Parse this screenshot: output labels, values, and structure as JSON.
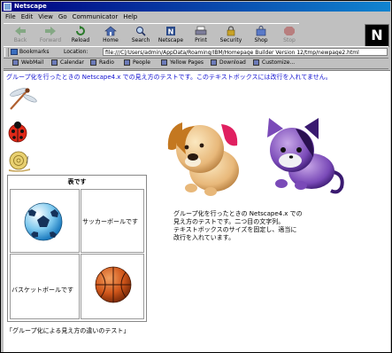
{
  "window": {
    "title": "Netscape"
  },
  "menu": [
    "File",
    "Edit",
    "View",
    "Go",
    "Communicator",
    "Help"
  ],
  "toolbar": {
    "buttons": [
      {
        "label": "Back",
        "icon": "back-arrow-icon",
        "enabled": false
      },
      {
        "label": "Forward",
        "icon": "forward-arrow-icon",
        "enabled": false
      },
      {
        "label": "Reload",
        "icon": "reload-icon",
        "enabled": true
      },
      {
        "label": "Home",
        "icon": "home-icon",
        "enabled": true
      },
      {
        "label": "Search",
        "icon": "search-icon",
        "enabled": true
      },
      {
        "label": "Netscape",
        "icon": "netscape-icon",
        "enabled": true
      },
      {
        "label": "Print",
        "icon": "print-icon",
        "enabled": true
      },
      {
        "label": "Security",
        "icon": "lock-icon",
        "enabled": true
      },
      {
        "label": "Shop",
        "icon": "shop-icon",
        "enabled": true
      },
      {
        "label": "Stop",
        "icon": "stop-icon",
        "enabled": false
      }
    ],
    "logo_letter": "N"
  },
  "location": {
    "bookmarks_label": "Bookmarks",
    "label": "Location:",
    "url": "file:///C|/Users/admin/AppData/Roaming/IBM/Homepage Builder Version 12/tmp/newpage2.html"
  },
  "links": [
    "WebMail",
    "Calendar",
    "Radio",
    "People",
    "Yellow Pages",
    "Download",
    "Customize..."
  ],
  "page": {
    "headline": "グループ化を行ったときの Netscape4.x での見え方のテストです。このテキストボックスには改行を入れてません。",
    "table": {
      "caption": "表です",
      "soccer_text": "サッカーボールです",
      "basketball_text": "バスケットボールです"
    },
    "desc_lines": [
      "グループ化を行ったときの Netscape4.x での",
      "見え方のテストです。二つ目の文字列。",
      "テキストボックスのサイズを固定し、適当に",
      "改行を入れています。"
    ],
    "footnote": "「グループ化による見え方の違いのテスト」"
  }
}
